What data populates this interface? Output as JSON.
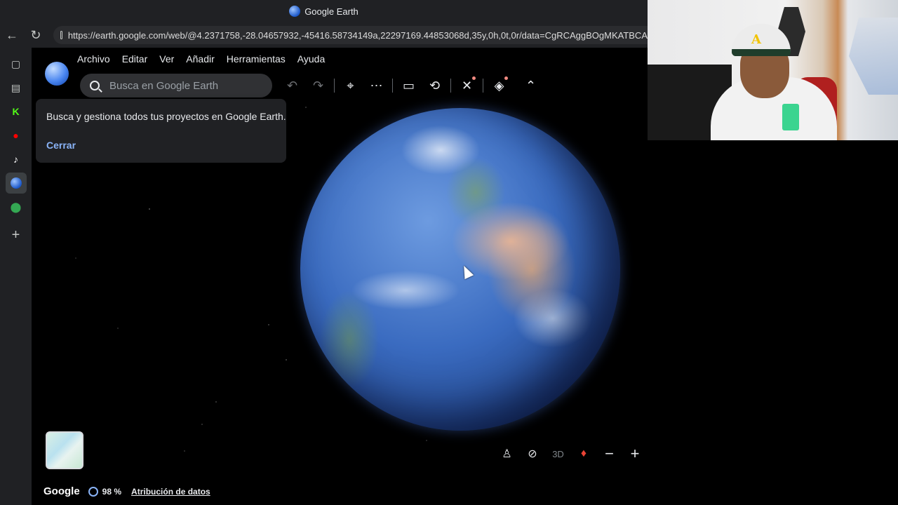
{
  "window": {
    "title": "Google Earth"
  },
  "browser": {
    "url": "https://earth.google.com/web/@4.2371758,-28.04657932,-45416.58734149a,22297169.44853068d,35y,0h,0t,0r/data=CgRCAggBOgMKATBCA"
  },
  "menu": {
    "items": [
      "Archivo",
      "Editar",
      "Ver",
      "Añadir",
      "Herramientas",
      "Ayuda"
    ]
  },
  "search": {
    "placeholder": "Busca en Google Earth"
  },
  "popup": {
    "text": "Busca y gestiona todos tus proyectos en Google Earth.",
    "close_label": "Cerrar"
  },
  "status": {
    "brand": "Google",
    "load_percent": "98 %",
    "attribution": "Atribución de datos"
  },
  "controls": {
    "view_3d": "3D"
  },
  "icons": {
    "sidebar": [
      "tabs-icon",
      "reading-list-icon",
      "kick-icon",
      "youtube-icon",
      "tiktok-icon",
      "google-earth-icon",
      "google-maps-icon",
      "add-icon"
    ]
  },
  "colors": {
    "accent": "#8ab4f8",
    "alert_dot": "#f28b82"
  }
}
